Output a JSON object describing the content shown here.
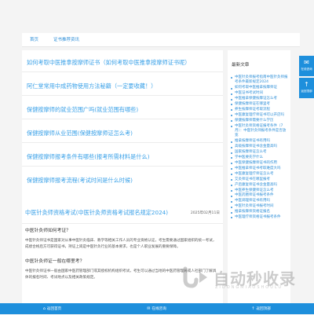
{
  "nav": {
    "home": "首页",
    "category": "证书推荐资讯"
  },
  "related_links": [
    "如何考取中医推拿按摩师证书（如何考取中医推拿按摩师证书呢）",
    "阿仁堂常用中成药物使用方法秘籍（一定要收藏！）",
    "保健按摩师的就业范围广吗(就业范围有哪些)",
    "保健按摩师从业范围(保健按摩师证怎么考)",
    "保健按摩师报考条件有哪些(报考所需材料是什么)",
    "保健按摩师报考流程(考试时间是什么时候)"
  ],
  "article": {
    "title": "中医针灸师资格考试(中医针灸师资格考试报名规定2024)",
    "date": "2025年02月11日",
    "q1": "中医针灸师如何考证？",
    "p1": "中医针灸师证书是国家对从事中医针灸临床、教学等相关工作人员的专业资格认证，考生需要通过国家组织的统一考试，成绩合格后方可获得证书，持证上岗是中医针灸行业的基本要求，也是个人职业发展的重要保障。",
    "q2": "中医针灸师证一般在哪里考？",
    "p2": "中医针灸师证书一般由国家中医药管理部门或其授权机构组织考试，考生可以通过当地的中医药管理局或人社部门了解具体的报名时间、考试地点以及相关政策规定。"
  },
  "sidebar": {
    "title": "最新文章",
    "items": [
      "中医针灸师报考指南中医针灸师报考条件最新规定2024",
      "如何考取中医推拿按摩师证",
      "中医证书考试时间",
      "中医推拿保健按摩证怎么考",
      "保健按摩师证在哪里考",
      "养生按摩师证考取流程",
      "中医康复理疗师证书可以开店吗",
      "保健按摩师需要什么学历",
      "中医针灸师资格证报考条件（7月）：中医针灸师报考条件是否放宽",
      "推拿按摩师证书有用吗",
      "高级按摩师证书含金量高吗",
      "国家按摩师证怎么考",
      "学中医要先学什么",
      "中医保健按摩师证书的作用",
      "中医推拿师证书考取难度大吗",
      "中医康复理疗师证怎么考",
      "艾灸师证书在哪里报考",
      "产后康复师证书含金量高吗",
      "中医养生保健师证怎么考",
      "中医药膳师证书报考条件",
      "中医调理师证书有用吗",
      "中医针灸师证书报考时间",
      "推拿按摩师资格证报名",
      "中医理疗师资格证书报考条件"
    ]
  },
  "float": {
    "btn1_label": "在线咨询",
    "btn1_icon": "chat-icon",
    "btn2_label": "返回顶部",
    "btn2_icon": "arrow-up-icon"
  },
  "watermark": {
    "text": "自动秒收录",
    "sub": "ZIDONGMIAOSHOULU"
  },
  "bottom": {
    "item1": "返回首页",
    "item2": "在线咨询",
    "item3": "返回顶部"
  },
  "colors": {
    "link": "#3aa1e8",
    "accent": "#1e8fdc",
    "background": "#f4f4f4"
  }
}
